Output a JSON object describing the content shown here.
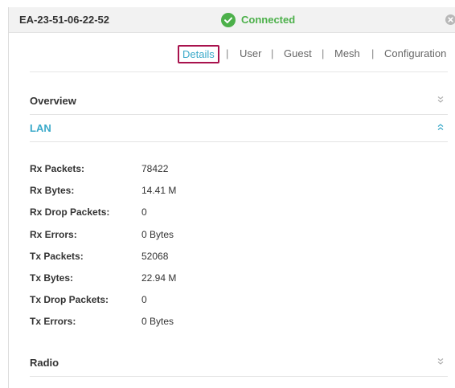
{
  "header": {
    "device_name": "EA-23-51-06-22-52",
    "status_text": "Connected",
    "status_color": "#4cb04a"
  },
  "tabs": [
    {
      "label": "Details",
      "active": true
    },
    {
      "label": "User",
      "active": false
    },
    {
      "label": "Guest",
      "active": false
    },
    {
      "label": "Mesh",
      "active": false
    },
    {
      "label": "Configuration",
      "active": false
    }
  ],
  "tab_separator": "|",
  "sections": {
    "overview": {
      "title": "Overview",
      "expanded": false
    },
    "lan": {
      "title": "LAN",
      "expanded": true
    },
    "radio": {
      "title": "Radio",
      "expanded": false
    }
  },
  "lan_stats": [
    {
      "label": "Rx Packets:",
      "value": "78422"
    },
    {
      "label": "Rx Bytes:",
      "value": "14.41 M"
    },
    {
      "label": "Rx Drop Packets:",
      "value": "0"
    },
    {
      "label": "Rx Errors:",
      "value": "0 Bytes"
    },
    {
      "label": "Tx Packets:",
      "value": "52068"
    },
    {
      "label": "Tx Bytes:",
      "value": "22.94 M"
    },
    {
      "label": "Tx Drop Packets:",
      "value": "0"
    },
    {
      "label": "Tx Errors:",
      "value": "0 Bytes"
    }
  ],
  "colors": {
    "accent": "#3aa9c9",
    "active_tab_border": "#a8124d",
    "text": "#333333"
  }
}
